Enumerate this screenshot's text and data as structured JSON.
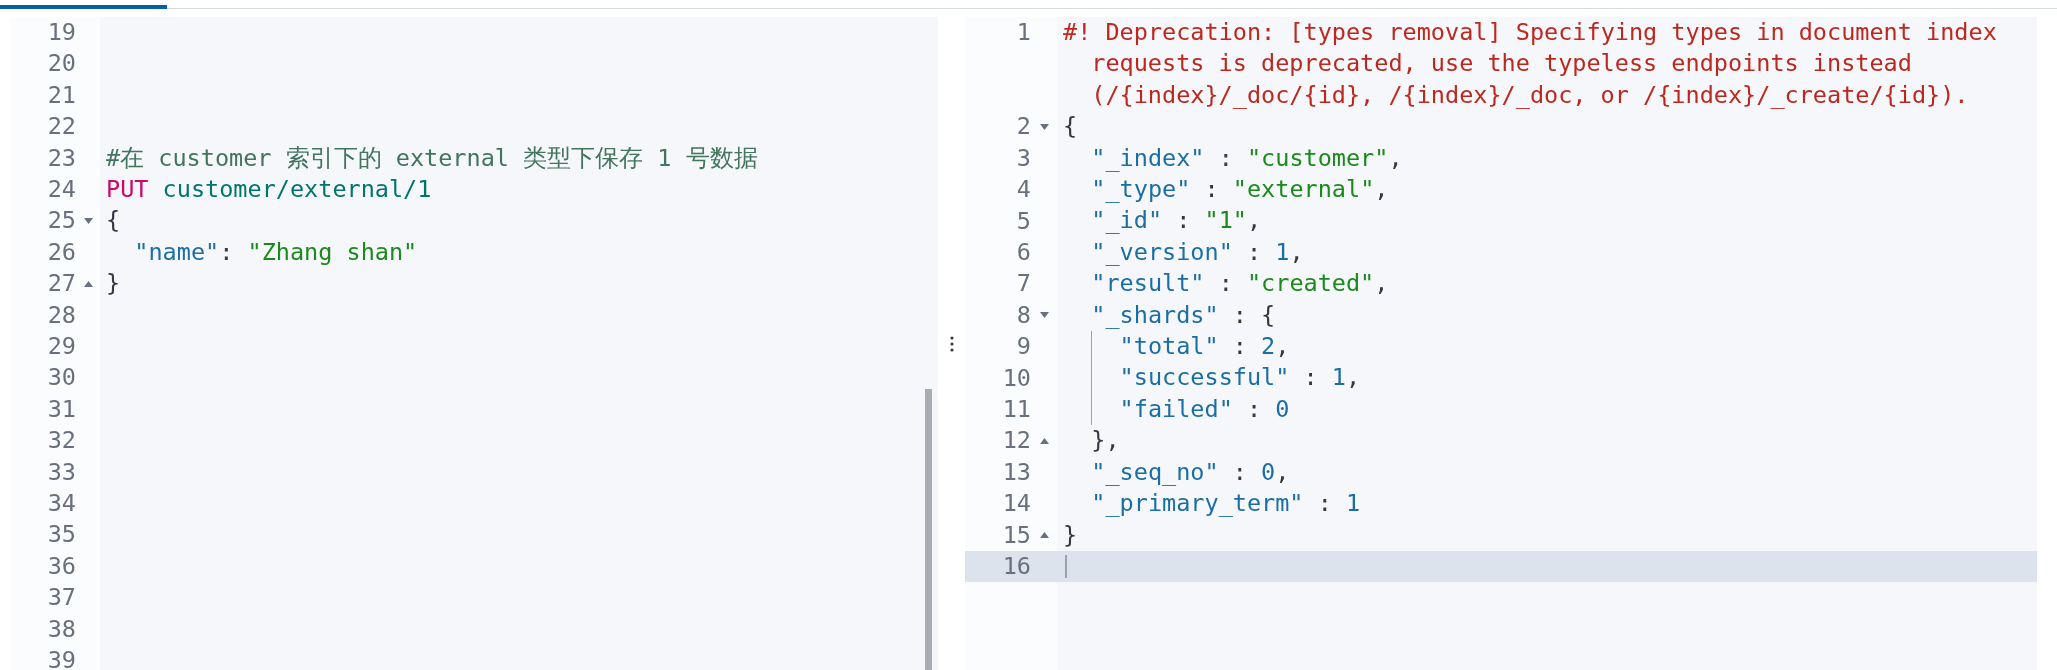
{
  "tabs": [
    {
      "selected": true
    }
  ],
  "request_editor": {
    "lines": [
      {
        "number": "19",
        "kind": "plain"
      },
      {
        "number": "20",
        "kind": "plain"
      },
      {
        "number": "21",
        "kind": "plain"
      },
      {
        "number": "22",
        "kind": "plain"
      },
      {
        "number": "23",
        "kind": "plain",
        "tokens": [
          {
            "kind": "comment",
            "text": "#在 customer 索引下的 external 类型下保存 1 号数据"
          }
        ]
      },
      {
        "number": "24",
        "kind": "plain",
        "tokens": [
          {
            "kind": "method",
            "text": "PUT"
          },
          {
            "kind": "path",
            "text": " customer/external/1"
          }
        ]
      },
      {
        "number": "25",
        "kind": "fold_start",
        "tokens": [
          {
            "kind": "punct",
            "text": "{"
          }
        ]
      },
      {
        "number": "26",
        "kind": "plain",
        "tokens": [
          {
            "kind": "key",
            "text": "  \"name\""
          },
          {
            "kind": "punct",
            "text": ": "
          },
          {
            "kind": "string",
            "text": "\"Zhang shan\""
          }
        ]
      },
      {
        "number": "27",
        "kind": "fold_end",
        "tokens": [
          {
            "kind": "punct",
            "text": "}"
          }
        ]
      },
      {
        "number": "28",
        "kind": "plain"
      },
      {
        "number": "29",
        "kind": "plain"
      },
      {
        "number": "30",
        "kind": "plain"
      },
      {
        "number": "31",
        "kind": "plain"
      },
      {
        "number": "32",
        "kind": "plain"
      },
      {
        "number": "33",
        "kind": "plain"
      },
      {
        "number": "34",
        "kind": "plain"
      },
      {
        "number": "35",
        "kind": "plain"
      },
      {
        "number": "36",
        "kind": "plain"
      },
      {
        "number": "37",
        "kind": "plain"
      },
      {
        "number": "38",
        "kind": "plain"
      },
      {
        "number": "39",
        "kind": "plain"
      }
    ]
  },
  "response_editor": {
    "lines": [
      {
        "number": "1",
        "kind": "plain",
        "active": false,
        "tokens": [
          {
            "kind": "warning",
            "text": "#! Deprecation: [types removal] Specifying types in document index requests is deprecated, use the typeless endpoints instead (/{index}/_doc/{id}, /{index}/_doc, or /{index}/_create/{id})."
          }
        ]
      },
      {
        "number": "2",
        "kind": "fold_start",
        "active": false,
        "tokens": [
          {
            "kind": "punct",
            "text": "{"
          }
        ]
      },
      {
        "number": "3",
        "kind": "plain",
        "active": false,
        "tokens": [
          {
            "kind": "key",
            "text": "  \"_index\""
          },
          {
            "kind": "punct",
            "text": " : "
          },
          {
            "kind": "string",
            "text": "\"customer\""
          },
          {
            "kind": "punct",
            "text": ","
          }
        ]
      },
      {
        "number": "4",
        "kind": "plain",
        "active": false,
        "tokens": [
          {
            "kind": "key",
            "text": "  \"_type\""
          },
          {
            "kind": "punct",
            "text": " : "
          },
          {
            "kind": "string",
            "text": "\"external\""
          },
          {
            "kind": "punct",
            "text": ","
          }
        ]
      },
      {
        "number": "5",
        "kind": "plain",
        "active": false,
        "tokens": [
          {
            "kind": "key",
            "text": "  \"_id\""
          },
          {
            "kind": "punct",
            "text": " : "
          },
          {
            "kind": "string",
            "text": "\"1\""
          },
          {
            "kind": "punct",
            "text": ","
          }
        ]
      },
      {
        "number": "6",
        "kind": "plain",
        "active": false,
        "tokens": [
          {
            "kind": "key",
            "text": "  \"_version\""
          },
          {
            "kind": "punct",
            "text": " : "
          },
          {
            "kind": "number",
            "text": "1"
          },
          {
            "kind": "punct",
            "text": ","
          }
        ]
      },
      {
        "number": "7",
        "kind": "plain",
        "active": false,
        "tokens": [
          {
            "kind": "key",
            "text": "  \"result\""
          },
          {
            "kind": "punct",
            "text": " : "
          },
          {
            "kind": "string",
            "text": "\"created\""
          },
          {
            "kind": "punct",
            "text": ","
          }
        ]
      },
      {
        "number": "8",
        "kind": "fold_start",
        "active": false,
        "tokens": [
          {
            "kind": "key",
            "text": "  \"_shards\""
          },
          {
            "kind": "punct",
            "text": " : {"
          }
        ]
      },
      {
        "number": "9",
        "kind": "plain",
        "active": false,
        "tokens": [
          {
            "kind": "key",
            "text": "    \"total\""
          },
          {
            "kind": "punct",
            "text": " : "
          },
          {
            "kind": "number",
            "text": "2"
          },
          {
            "kind": "punct",
            "text": ","
          }
        ]
      },
      {
        "number": "10",
        "kind": "plain",
        "active": false,
        "tokens": [
          {
            "kind": "key",
            "text": "    \"successful\""
          },
          {
            "kind": "punct",
            "text": " : "
          },
          {
            "kind": "number",
            "text": "1"
          },
          {
            "kind": "punct",
            "text": ","
          }
        ]
      },
      {
        "number": "11",
        "kind": "plain",
        "active": false,
        "tokens": [
          {
            "kind": "key",
            "text": "    \"failed\""
          },
          {
            "kind": "punct",
            "text": " : "
          },
          {
            "kind": "number",
            "text": "0"
          }
        ]
      },
      {
        "number": "12",
        "kind": "fold_end",
        "active": false,
        "tokens": [
          {
            "kind": "punct",
            "text": "  },"
          }
        ]
      },
      {
        "number": "13",
        "kind": "plain",
        "active": false,
        "tokens": [
          {
            "kind": "key",
            "text": "  \"_seq_no\""
          },
          {
            "kind": "punct",
            "text": " : "
          },
          {
            "kind": "number",
            "text": "0"
          },
          {
            "kind": "punct",
            "text": ","
          }
        ]
      },
      {
        "number": "14",
        "kind": "plain",
        "active": false,
        "tokens": [
          {
            "kind": "key",
            "text": "  \"_primary_term\""
          },
          {
            "kind": "punct",
            "text": " : "
          },
          {
            "kind": "number",
            "text": "1"
          }
        ]
      },
      {
        "number": "15",
        "kind": "fold_end",
        "active": false,
        "tokens": [
          {
            "kind": "punct",
            "text": "}"
          }
        ]
      },
      {
        "number": "16",
        "kind": "plain",
        "active": true
      }
    ]
  }
}
